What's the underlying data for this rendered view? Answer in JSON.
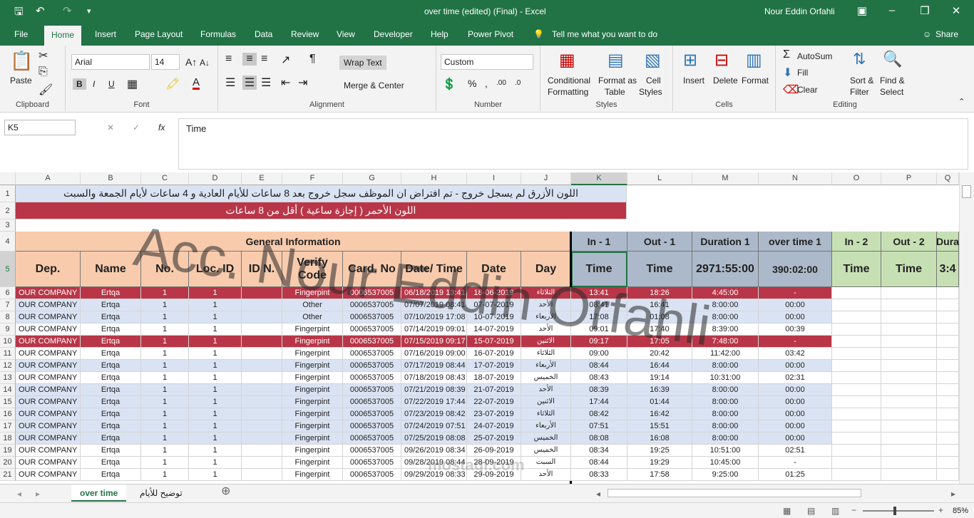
{
  "titlebar": {
    "doc_title": "over time (edited) (Final)  -  Excel",
    "user": "Nour Eddin Orfahli"
  },
  "menus": [
    "File",
    "Home",
    "Insert",
    "Page Layout",
    "Formulas",
    "Data",
    "Review",
    "View",
    "Developer",
    "Help",
    "Power Pivot"
  ],
  "tell_me": "Tell me what you want to do",
  "share": "Share",
  "ribbon": {
    "clipboard": {
      "paste": "Paste",
      "label": "Clipboard"
    },
    "font": {
      "name": "Arial",
      "size": "14",
      "bold": "B",
      "italic": "I",
      "underline": "U",
      "label": "Font"
    },
    "alignment": {
      "wrap": "Wrap Text",
      "merge": "Merge & Center",
      "label": "Alignment"
    },
    "number": {
      "format": "Custom",
      "label": "Number"
    },
    "styles": {
      "conditional": "Conditional",
      "formatting": "Formatting",
      "format_as": "Format as",
      "table": "Table",
      "cell": "Cell",
      "cell_styles": "Styles",
      "label": "Styles"
    },
    "cells": {
      "insert": "Insert",
      "delete": "Delete",
      "format": "Format",
      "label": "Cells"
    },
    "editing": {
      "autosum": "AutoSum",
      "fill": "Fill",
      "clear": "Clear",
      "sort": "Sort &",
      "filter": "Filter",
      "find": "Find &",
      "select": "Select",
      "label": "Editing"
    }
  },
  "formula": {
    "namebox": "K5",
    "fx": "fx",
    "content": "Time"
  },
  "columns": [
    "A",
    "B",
    "C",
    "D",
    "E",
    "F",
    "G",
    "H",
    "I",
    "J",
    "K",
    "L",
    "M",
    "N",
    "O",
    "P",
    "Q"
  ],
  "notes": {
    "row1": "اللون الأزرق لم يسجل خروج - تم افتراض ان الموظف سجل خروج بعد 8 ساعات للأيام العادية و 4 ساعات لأيام الجمعة والسبت",
    "row2": "اللون الأحمر ( إجازة ساعية ) أقل من 8 ساعات"
  },
  "header4": {
    "general": "General Information",
    "in1": "In - 1",
    "out1": "Out - 1",
    "dur1": "Duration 1",
    "ot1": "over time 1",
    "in2": "In - 2",
    "out2": "Out - 2",
    "dur2": "Dura"
  },
  "header5": {
    "dep": "Dep.",
    "name": "Name",
    "no": "No.",
    "loc": "Loc. ID",
    "idn": "ID N.",
    "verify": "Verify Code",
    "card": "Card. No",
    "datetime": "Date/ Time",
    "date": "Date",
    "day": "Day",
    "k": "Time",
    "l": "Time",
    "m": "2971:55:00",
    "n": "390:02:00",
    "o": "Time",
    "p": "Time",
    "q": "3:4"
  },
  "rows": [
    {
      "n": "6",
      "dep": "OUR COMPANY",
      "name": "Ertqa",
      "no": "1",
      "loc": "1",
      "verify": "Fingerpint",
      "card": "0006537005",
      "dt": "06/18/2019 13:41",
      "date": "18-06-2019",
      "day": "الثلاثاء",
      "in": "13:41",
      "out": "18:26",
      "dur": "4:45:00",
      "ot": "-",
      "style": "red"
    },
    {
      "n": "7",
      "dep": "OUR COMPANY",
      "name": "Ertqa",
      "no": "1",
      "loc": "1",
      "verify": "Other",
      "card": "0006537005",
      "dt": "07/07/2019 08:41",
      "date": "07-07-2019",
      "day": "الأحد",
      "in": "08:41",
      "out": "16:41",
      "dur": "8:00:00",
      "ot": "00:00",
      "style": "blue"
    },
    {
      "n": "8",
      "dep": "OUR COMPANY",
      "name": "Ertqa",
      "no": "1",
      "loc": "1",
      "verify": "Other",
      "card": "0006537005",
      "dt": "07/10/2019 17:08",
      "date": "10-07-2019",
      "day": "الأربعاء",
      "in": "17:08",
      "out": "01:08",
      "dur": "8:00:00",
      "ot": "00:00",
      "style": "blue"
    },
    {
      "n": "9",
      "dep": "OUR COMPANY",
      "name": "Ertqa",
      "no": "1",
      "loc": "1",
      "verify": "Fingerpint",
      "card": "0006537005",
      "dt": "07/14/2019 09:01",
      "date": "14-07-2019",
      "day": "الأحد",
      "in": "09:01",
      "out": "17:40",
      "dur": "8:39:00",
      "ot": "00:39",
      "style": "white"
    },
    {
      "n": "10",
      "dep": "OUR COMPANY",
      "name": "Ertqa",
      "no": "1",
      "loc": "1",
      "verify": "Fingerpint",
      "card": "0006537005",
      "dt": "07/15/2019 09:17",
      "date": "15-07-2019",
      "day": "الاثنين",
      "in": "09:17",
      "out": "17:05",
      "dur": "7:48:00",
      "ot": "-",
      "style": "red"
    },
    {
      "n": "11",
      "dep": "OUR COMPANY",
      "name": "Ertqa",
      "no": "1",
      "loc": "1",
      "verify": "Fingerpint",
      "card": "0006537005",
      "dt": "07/16/2019 09:00",
      "date": "16-07-2019",
      "day": "الثلاثاء",
      "in": "09:00",
      "out": "20:42",
      "dur": "11:42:00",
      "ot": "03:42",
      "style": "white"
    },
    {
      "n": "12",
      "dep": "OUR COMPANY",
      "name": "Ertqa",
      "no": "1",
      "loc": "1",
      "verify": "Fingerpint",
      "card": "0006537005",
      "dt": "07/17/2019 08:44",
      "date": "17-07-2019",
      "day": "الأربعاء",
      "in": "08:44",
      "out": "16:44",
      "dur": "8:00:00",
      "ot": "00:00",
      "style": "blue"
    },
    {
      "n": "13",
      "dep": "OUR COMPANY",
      "name": "Ertqa",
      "no": "1",
      "loc": "1",
      "verify": "Fingerpint",
      "card": "0006537005",
      "dt": "07/18/2019 08:43",
      "date": "18-07-2019",
      "day": "الخميس",
      "in": "08:43",
      "out": "19:14",
      "dur": "10:31:00",
      "ot": "02:31",
      "style": "white"
    },
    {
      "n": "14",
      "dep": "OUR COMPANY",
      "name": "Ertqa",
      "no": "1",
      "loc": "1",
      "verify": "Fingerpint",
      "card": "0006537005",
      "dt": "07/21/2019 08:39",
      "date": "21-07-2019",
      "day": "الأحد",
      "in": "08:39",
      "out": "16:39",
      "dur": "8:00:00",
      "ot": "00:00",
      "style": "blue"
    },
    {
      "n": "15",
      "dep": "OUR COMPANY",
      "name": "Ertqa",
      "no": "1",
      "loc": "1",
      "verify": "Fingerpint",
      "card": "0006537005",
      "dt": "07/22/2019 17:44",
      "date": "22-07-2019",
      "day": "الاثنين",
      "in": "17:44",
      "out": "01:44",
      "dur": "8:00:00",
      "ot": "00:00",
      "style": "blue"
    },
    {
      "n": "16",
      "dep": "OUR COMPANY",
      "name": "Ertqa",
      "no": "1",
      "loc": "1",
      "verify": "Fingerpint",
      "card": "0006537005",
      "dt": "07/23/2019 08:42",
      "date": "23-07-2019",
      "day": "الثلاثاء",
      "in": "08:42",
      "out": "16:42",
      "dur": "8:00:00",
      "ot": "00:00",
      "style": "blue"
    },
    {
      "n": "17",
      "dep": "OUR COMPANY",
      "name": "Ertqa",
      "no": "1",
      "loc": "1",
      "verify": "Fingerpint",
      "card": "0006537005",
      "dt": "07/24/2019 07:51",
      "date": "24-07-2019",
      "day": "الأربعاء",
      "in": "07:51",
      "out": "15:51",
      "dur": "8:00:00",
      "ot": "00:00",
      "style": "blue"
    },
    {
      "n": "18",
      "dep": "OUR COMPANY",
      "name": "Ertqa",
      "no": "1",
      "loc": "1",
      "verify": "Fingerpint",
      "card": "0006537005",
      "dt": "07/25/2019 08:08",
      "date": "25-07-2019",
      "day": "الخميس",
      "in": "08:08",
      "out": "16:08",
      "dur": "8:00:00",
      "ot": "00:00",
      "style": "blue"
    },
    {
      "n": "19",
      "dep": "OUR COMPANY",
      "name": "Ertqa",
      "no": "1",
      "loc": "1",
      "verify": "Fingerpint",
      "card": "0006537005",
      "dt": "09/26/2019 08:34",
      "date": "26-09-2019",
      "day": "الخميس",
      "in": "08:34",
      "out": "19:25",
      "dur": "10:51:00",
      "ot": "02:51",
      "style": "white"
    },
    {
      "n": "20",
      "dep": "OUR COMPANY",
      "name": "Ertqa",
      "no": "1",
      "loc": "1",
      "verify": "Fingerpint",
      "card": "0006537005",
      "dt": "09/28/2019 08:44",
      "date": "28-09-2019",
      "day": "السبت",
      "in": "08:44",
      "out": "19:29",
      "dur": "10:45:00",
      "ot": "-",
      "style": "white"
    },
    {
      "n": "21",
      "dep": "OUR COMPANY",
      "name": "Ertqa",
      "no": "1",
      "loc": "1",
      "verify": "Fingerpint",
      "card": "0006537005",
      "dt": "09/29/2019 08:33",
      "date": "29-09-2019",
      "day": "الأحد",
      "in": "08:33",
      "out": "17:58",
      "dur": "9:25:00",
      "ot": "01:25",
      "style": "white"
    }
  ],
  "sheets": {
    "active": "over time",
    "other": "توضيح للأيام"
  },
  "watermark": "Acc. Nour Eddin Orfahli",
  "mostaql": "mostaql.com",
  "zoom": "85%",
  "colors": {
    "green": "#217346",
    "red_row": "#b83648",
    "blue_row": "#dae3f3",
    "peach": "#f8cbad",
    "gray_blue": "#acb9ca",
    "light_green": "#c6e0b4"
  }
}
